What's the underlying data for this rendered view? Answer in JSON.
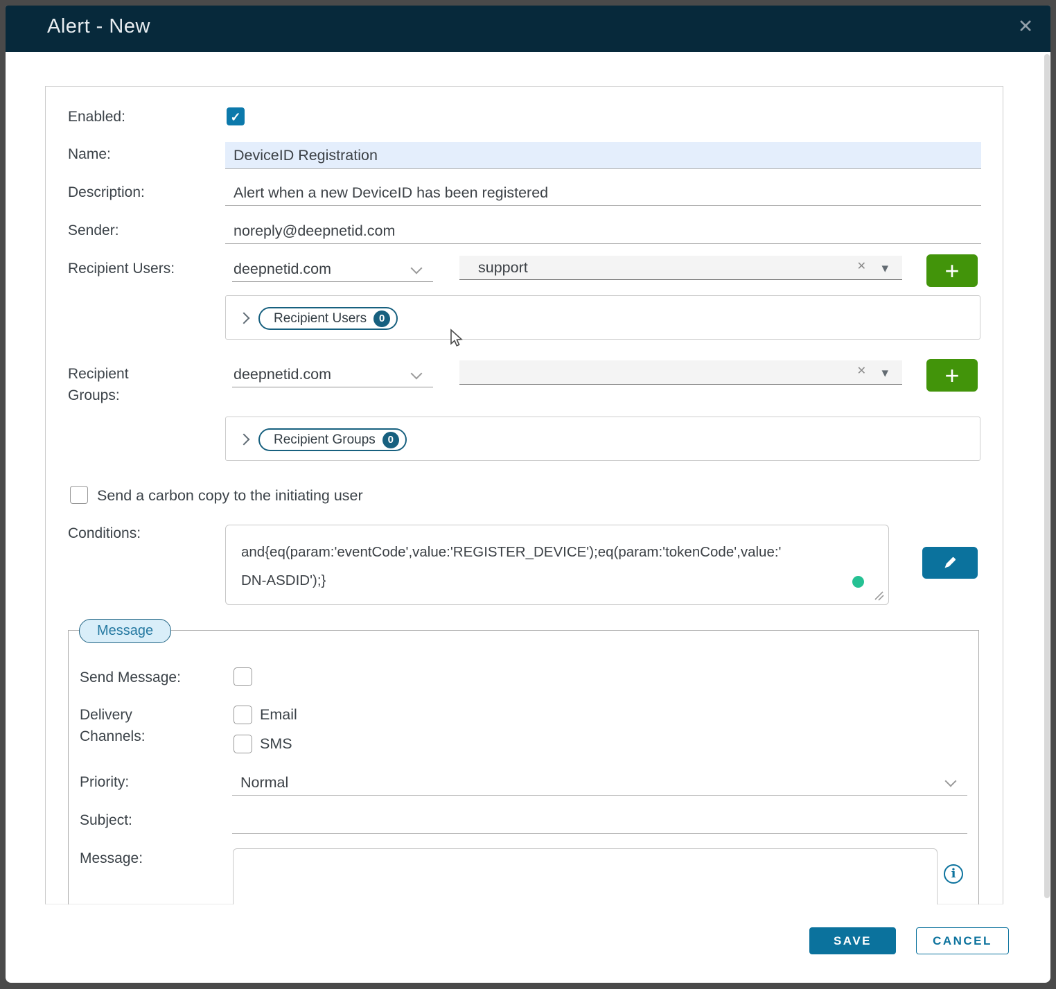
{
  "dialog": {
    "title": "Alert - New"
  },
  "icons": {
    "check": "✓",
    "close": "✕",
    "clear": "✕",
    "dropdown_triangle": "▾",
    "plus": "+",
    "info": "i"
  },
  "colors": {
    "header_bg": "#07293b",
    "primary_blue": "#0b729d",
    "checkbox_blue": "#0c79ab",
    "add_green": "#42940a",
    "condition_dot_green": "#25c193",
    "pill_teal": "#17607f",
    "name_field_bg": "#e4eefc",
    "legend_pill_bg": "#d9eef9"
  },
  "fields": {
    "enabled": {
      "label": "Enabled:",
      "checked": true
    },
    "name": {
      "label": "Name:",
      "value": "DeviceID Registration"
    },
    "description": {
      "label": "Description:",
      "value": "Alert when a new DeviceID has been registered"
    },
    "sender": {
      "label": "Sender:",
      "value": "noreply@deepnetid.com"
    },
    "recipient_users": {
      "label": "Recipient Users:",
      "domain_value": "deepnetid.com",
      "user_value": "support",
      "panel": {
        "label": "Recipient Users",
        "count": "0"
      }
    },
    "recipient_groups": {
      "label": "Recipient Groups:",
      "domain_value": "deepnetid.com",
      "group_value": "",
      "panel": {
        "label": "Recipient Groups",
        "count": "0"
      }
    },
    "carbon_copy": {
      "label": "Send a carbon copy to the initiating user",
      "checked": false
    },
    "conditions": {
      "label": "Conditions:",
      "value": "and{eq(param:'eventCode',value:'REGISTER_DEVICE');eq(param:'tokenCode',value:'DN-ASDID');}",
      "line1": "and{eq(param:'eventCode',value:'REGISTER_DEVICE');eq(param:'tokenCode',value:'",
      "line2": "DN-ASDID');}"
    }
  },
  "message_section": {
    "legend": "Message",
    "send_message": {
      "label": "Send Message:",
      "checked": false
    },
    "delivery_channels": {
      "label": "Delivery Channels:",
      "options": [
        "Email",
        "SMS"
      ]
    },
    "priority": {
      "label": "Priority:",
      "value": "Normal"
    },
    "subject": {
      "label": "Subject:",
      "value": ""
    },
    "message": {
      "label": "Message:",
      "value": ""
    }
  },
  "footer": {
    "save": "SAVE",
    "cancel": "CANCEL"
  }
}
